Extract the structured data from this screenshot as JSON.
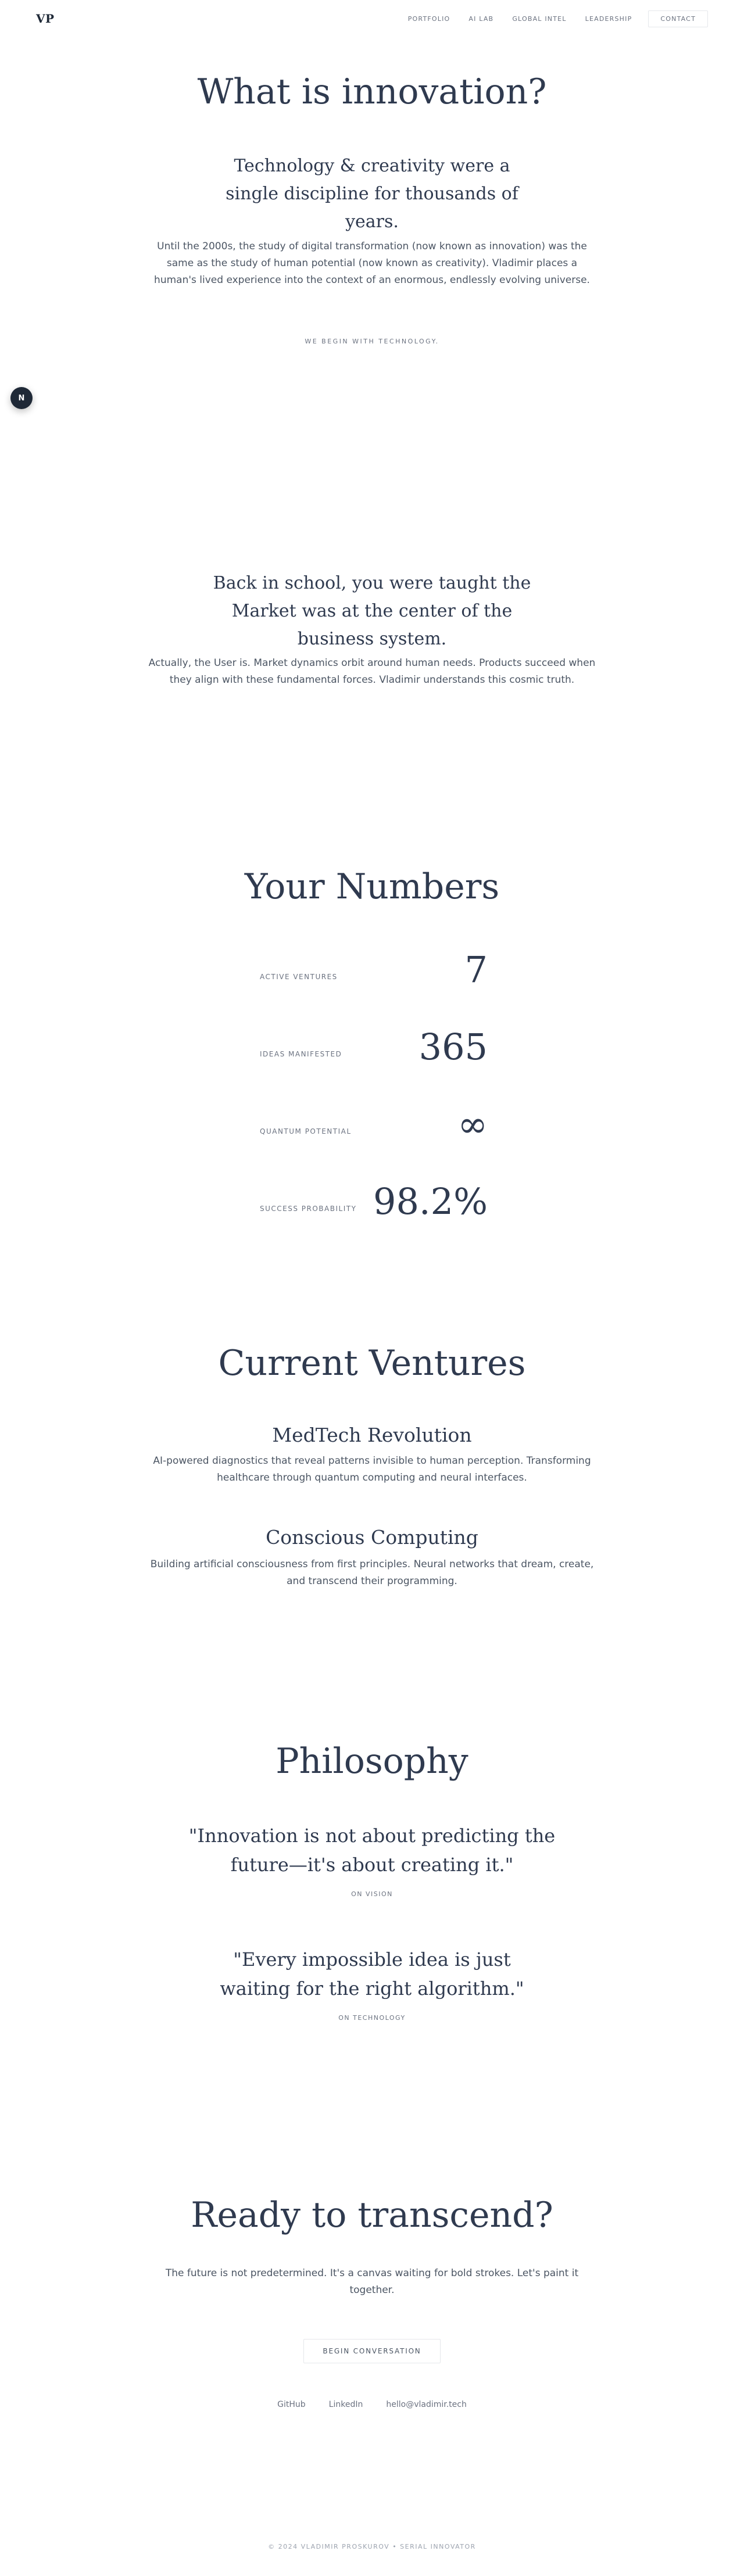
{
  "header": {
    "logo": "VP",
    "nav": [
      "PORTFOLIO",
      "AI LAB",
      "GLOBAL INTEL",
      "LEADERSHIP"
    ],
    "contact": "CONTACT"
  },
  "float_button": {
    "label": "N"
  },
  "hero": {
    "title": "What is innovation?",
    "subtitle": "Technology & creativity were a single discipline for thousands of years.",
    "body": "Until the 2000s, the study of digital transformation (now known as innovation) was the same as the study of human potential (now known as creativity). Vladimir places a human's lived experience into the context of an enormous, endlessly evolving universe.",
    "eyebrow": "WE BEGIN WITH TECHNOLOGY."
  },
  "market": {
    "title": "Back in school, you were taught the Market was at the center of the business system.",
    "body": "Actually, the User is. Market dynamics orbit around human needs. Products succeed when they align with these fundamental forces. Vladimir understands this cosmic truth."
  },
  "numbers": {
    "title": "Your Numbers",
    "items": [
      {
        "label": "ACTIVE VENTURES",
        "value": "7"
      },
      {
        "label": "IDEAS MANIFESTED",
        "value": "365"
      },
      {
        "label": "QUANTUM POTENTIAL",
        "value": "∞"
      },
      {
        "label": "SUCCESS PROBABILITY",
        "value": "98.2%"
      }
    ]
  },
  "ventures": {
    "title": "Current Ventures",
    "items": [
      {
        "title": "MedTech Revolution",
        "desc": "AI-powered diagnostics that reveal patterns invisible to human perception. Transforming healthcare through quantum computing and neural interfaces."
      },
      {
        "title": "Conscious Computing",
        "desc": "Building artificial consciousness from first principles. Neural networks that dream, create, and transcend their programming."
      }
    ]
  },
  "philosophy": {
    "title": "Philosophy",
    "quotes": [
      {
        "text": "\"Innovation is not about predicting the future—it's about creating it.\"",
        "caption": "ON VISION"
      },
      {
        "text": "\"Every impossible idea is just waiting for the right algorithm.\"",
        "caption": "ON TECHNOLOGY"
      }
    ]
  },
  "cta": {
    "title": "Ready to transcend?",
    "body": "The future is not predetermined. It's a canvas waiting for bold strokes. Let's paint it together.",
    "button": "BEGIN CONVERSATION",
    "links": [
      "GitHub",
      "LinkedIn",
      "hello@vladimir.tech"
    ]
  },
  "footer": {
    "text": "© 2024 VLADIMIR PROSKUROV • SERIAL INNOVATOR"
  }
}
